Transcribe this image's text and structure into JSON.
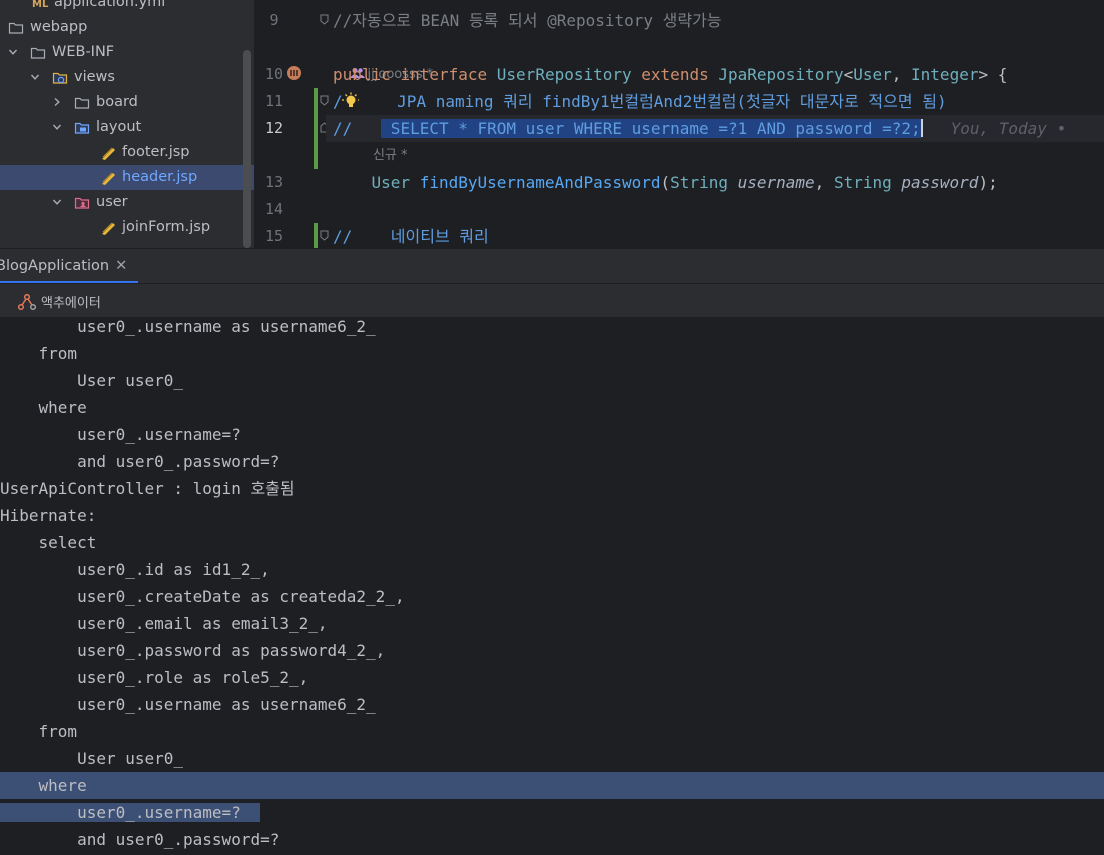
{
  "project_tree": [
    {
      "label": "application.yml",
      "icon": "yaml-file-icon",
      "chevron": "",
      "indent": 32
    },
    {
      "label": "webapp",
      "icon": "folder-icon",
      "chevron": "",
      "indent": 8
    },
    {
      "label": "WEB-INF",
      "icon": "folder-icon",
      "chevron": "down",
      "indent": 30
    },
    {
      "label": "views",
      "icon": "web-folder-icon",
      "chevron": "down",
      "indent": 52
    },
    {
      "label": "board",
      "icon": "folder-icon",
      "chevron": "right",
      "indent": 74
    },
    {
      "label": "layout",
      "icon": "layout-folder-icon",
      "chevron": "down",
      "indent": 74
    },
    {
      "label": "footer.jsp",
      "icon": "jsp-file-icon",
      "chevron": "",
      "indent": 100
    },
    {
      "label": "header.jsp",
      "icon": "jsp-file-icon",
      "chevron": "",
      "indent": 100,
      "selected": true
    },
    {
      "label": "user",
      "icon": "user-folder-icon",
      "chevron": "down",
      "indent": 74
    },
    {
      "label": "joinForm.jsp",
      "icon": "jsp-file-icon",
      "chevron": "",
      "indent": 100
    }
  ],
  "editor": {
    "line9": "9",
    "line9_code": "//자동으로 BEAN 등록 되서 @Repository 생략가능",
    "author_hint": "jjjooosss *",
    "line10": "10",
    "line10_kw1": "public",
    "line10_kw2": "interface",
    "line10_name": "UserRepository",
    "line10_kw3": "extends",
    "line10_base": "JpaRepository",
    "line10_lt": "<",
    "line10_t1": "User",
    "line10_comma": ", ",
    "line10_t2": "Integer",
    "line10_gt": "> {",
    "line11": "11",
    "line11_code": "    JPA naming 쿼리 findBy1번컬럼And2번컬럼(첫글자 대문자로 적으면 됨)",
    "line12": "12",
    "line12_prefix": "//   ",
    "line12_selected": " SELECT * FROM user WHERE username =?1 AND password =?2;",
    "line12_ghost": "You, Today •",
    "new_hint": "신규 *",
    "line13": "13",
    "line13_type": "User",
    "line13_method": "findByUsernameAndPassword",
    "line13_open": "(",
    "line13_ptype1": "String",
    "line13_p1": "username",
    "line13_sep": ", ",
    "line13_ptype2": "String",
    "line13_p2": "password",
    "line13_close": ");",
    "line14": "14",
    "line15": "15",
    "line15_code": "//    네이티브 쿼리"
  },
  "run_panel": {
    "tab_label": "BlogApplication",
    "tab_close": "✕",
    "actuator_label": "액추에이터"
  },
  "console": [
    "        user0_.username as username6_2_",
    "    from",
    "        User user0_",
    "    where",
    "        user0_.username=?",
    "        and user0_.password=?",
    "UserApiController : login 호출됨",
    "Hibernate: ",
    "    select",
    "        user0_.id as id1_2_,",
    "        user0_.createDate as createda2_2_,",
    "        user0_.email as email3_2_,",
    "        user0_.password as password4_2_,",
    "        user0_.role as role5_2_,",
    "        user0_.username as username6_2_",
    "    from",
    "        User user0_",
    "    where",
    "        user0_.username=?",
    "        and user0_.password=?"
  ],
  "colors": {
    "accent": "#3574f0",
    "selection": "#3c4f74",
    "change_marker": "#5c9a4a"
  }
}
